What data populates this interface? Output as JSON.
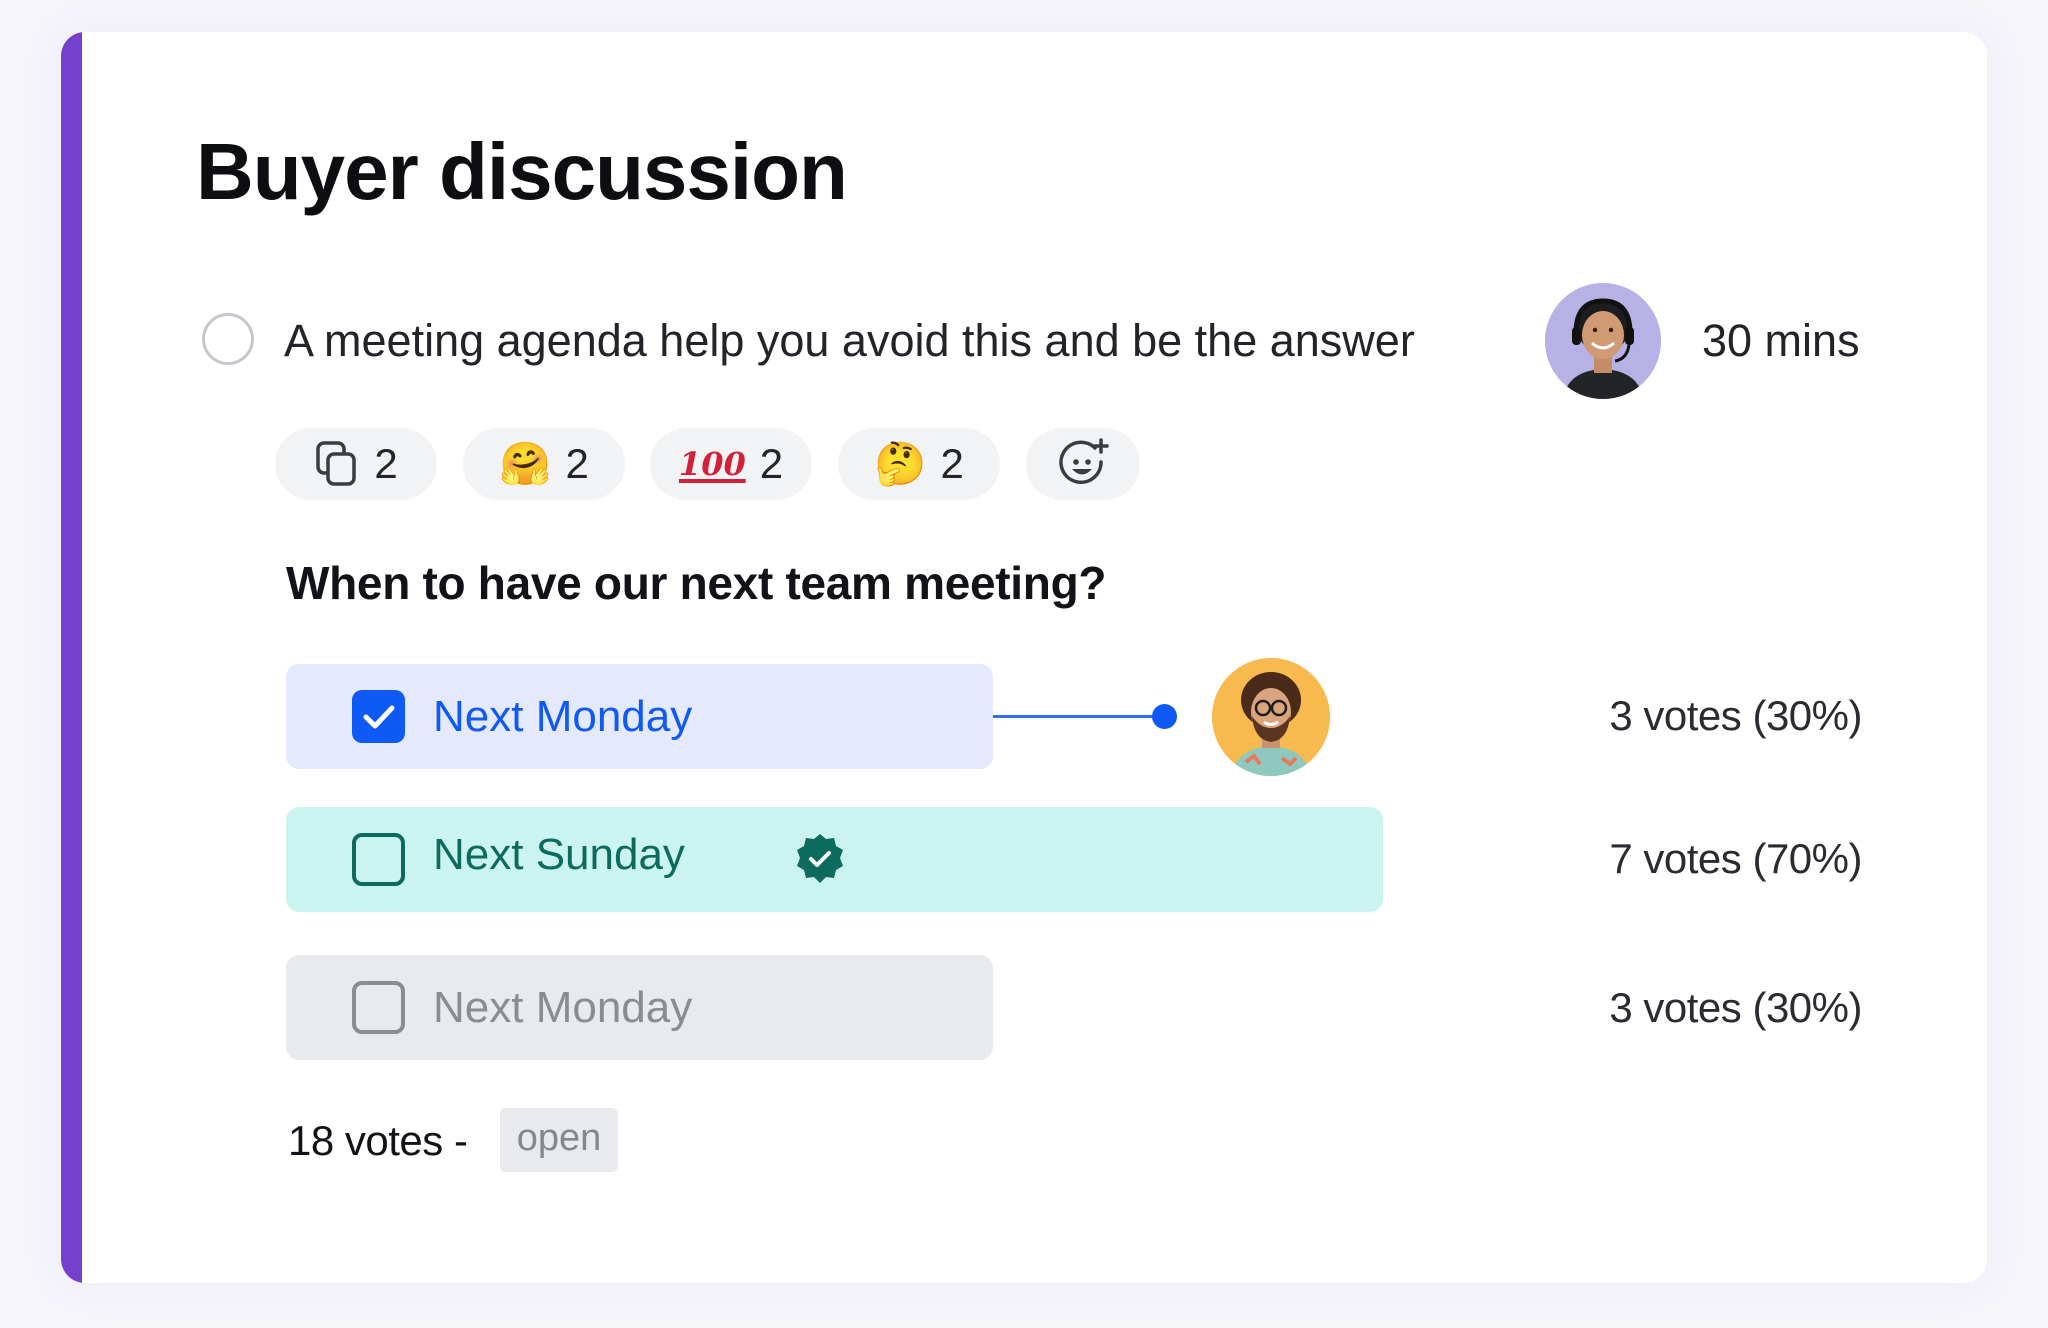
{
  "card": {
    "title": "Buyer discussion",
    "accent_color": "#7540cc"
  },
  "agenda_item": {
    "checked": false,
    "text": "A meeting agenda help you avoid this and be the answer",
    "owner_avatar": "avatar-woman-headset",
    "duration": "30 mins"
  },
  "reactions": [
    {
      "icon": "copy-icon",
      "count": "2"
    },
    {
      "icon": "hugging-face-emoji",
      "glyph": "🤗",
      "count": "2"
    },
    {
      "icon": "hundred-points-emoji",
      "glyph": "100",
      "count": "2"
    },
    {
      "icon": "thinking-face-emoji",
      "glyph": "🤔",
      "count": "2"
    },
    {
      "icon": "add-reaction-icon",
      "count": ""
    }
  ],
  "poll": {
    "question": "When to have our next team meeting?",
    "options": [
      {
        "label": "Next Monday",
        "checked": true,
        "votes": 3,
        "percent": 30,
        "votes_text": "3 votes (30%)",
        "state": "selected",
        "color": "#0f5af5"
      },
      {
        "label": "Next Sunday",
        "checked": false,
        "votes": 7,
        "percent": 70,
        "votes_text": "7 votes (70%)",
        "state": "winner",
        "verified": true,
        "color": "#0c6b5c"
      },
      {
        "label": "Next Monday",
        "checked": false,
        "votes": 3,
        "percent": 30,
        "votes_text": "3 votes (30%)",
        "state": "default",
        "color": "#8a8c90"
      }
    ],
    "voter_avatar": "avatar-man-curly-hair",
    "total_votes": "18 votes",
    "separator": "-",
    "status": "open"
  }
}
